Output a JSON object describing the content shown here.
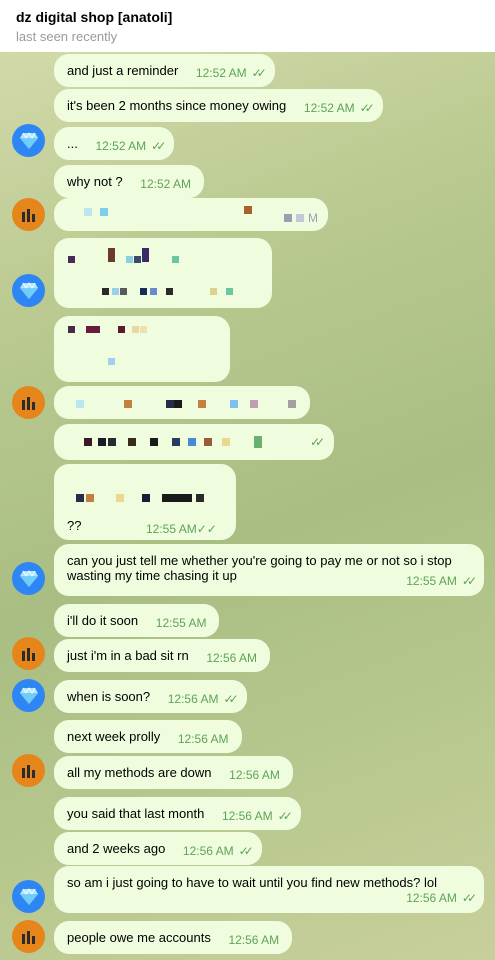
{
  "header": {
    "title": "dz digital shop [anatoli]",
    "subtitle": "last seen recently"
  },
  "colors": {
    "bubble": "#effdde",
    "meta": "#5ea358",
    "diamond_avatar": "#2e86f5",
    "shop_avatar": "#e5851a"
  },
  "messages": [
    {
      "text": "and just a reminder",
      "time": "12:52 AM",
      "ticks": "✓✓"
    },
    {
      "text": "it's been 2 months since money owing",
      "time": "12:52 AM",
      "ticks": "✓✓"
    },
    {
      "text": "...",
      "time": "12:52 AM",
      "ticks": "✓✓"
    },
    {
      "text": "why not ?",
      "time": "12:52 AM"
    },
    {
      "text": "??",
      "time": "12:55 AM",
      "ticks": "✓✓"
    },
    {
      "text": "can you just tell me whether you're going to pay me or not so i stop wasting my time chasing it up",
      "time": "12:55 AM",
      "ticks": "✓✓"
    },
    {
      "text": "i'll do it soon",
      "time": "12:55 AM"
    },
    {
      "text": "just i'm in a bad sit rn",
      "time": "12:56 AM"
    },
    {
      "text": "when is soon?",
      "time": "12:56 AM",
      "ticks": "✓✓"
    },
    {
      "text": "next week prolly",
      "time": "12:56 AM"
    },
    {
      "text": "all my methods are down",
      "time": "12:56 AM"
    },
    {
      "text": "you said that last month",
      "time": "12:56 AM",
      "ticks": "✓✓"
    },
    {
      "text": "and 2 weeks ago",
      "time": "12:56 AM",
      "ticks": "✓✓"
    },
    {
      "text": "so am i just going to have to wait until you find new methods? lol",
      "time": "12:56 AM",
      "ticks": "✓✓"
    },
    {
      "text": "people owe me accounts",
      "time": "12:56 AM"
    }
  ],
  "redacted_fragments": {
    "pm_suffix": "M"
  }
}
